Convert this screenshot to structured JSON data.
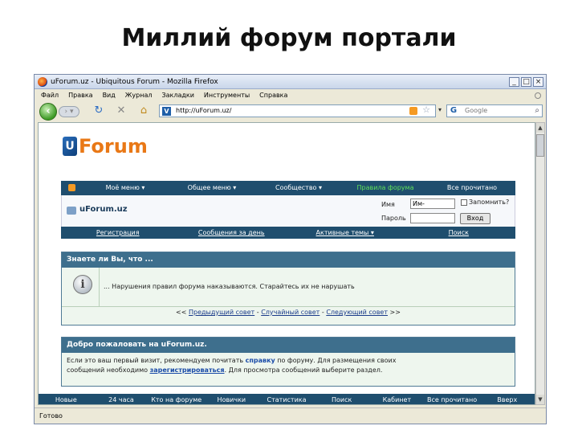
{
  "slide": {
    "title": "Миллий форум портали"
  },
  "browser": {
    "window_title": "uForum.uz - Ubiquitous Forum - Mozilla Firefox",
    "menu": [
      "Файл",
      "Правка",
      "Вид",
      "Журнал",
      "Закладки",
      "Инструменты",
      "Справка"
    ],
    "url": "http://uForum.uz/",
    "search_placeholder": "Google",
    "status": "Готово"
  },
  "forum": {
    "logo": {
      "mark": "U",
      "word": "Forum"
    },
    "top_nav": [
      "Моё меню ▾",
      "Общее меню ▾",
      "Сообщество ▾",
      "Правила форума",
      "Все прочитано"
    ],
    "site_name": "uForum.uz",
    "login": {
      "name_label": "Имя",
      "name_value": "Им-",
      "password_label": "Пароль",
      "remember_label": "Запомнить?",
      "button": "Вход"
    },
    "sub_nav": [
      "Регистрация",
      "Сообщения за день",
      "Активные темы ▾",
      "Поиск"
    ],
    "tip": {
      "header": "Знаете ли Вы, что ...",
      "text": "... Нарушения правил форума наказываются. Старайтесь их не нарушать",
      "prev_arrows": "<<",
      "prev": "Предыдущий совет",
      "sep1": "-",
      "random": "Случайный совет",
      "sep2": "-",
      "next": "Следующий совет",
      "next_arrows": ">>"
    },
    "welcome": {
      "header": "Добро пожаловать на uForum.uz.",
      "line1_a": "Если это ваш первый визит, рекомендуем почитать ",
      "line1_link": "справку",
      "line1_b": " по форуму. Для размещения своих",
      "line2_a": "сообщений необходимо ",
      "line2_link": "зарегистрироваться",
      "line2_b": ". Для просмотра сообщений выберите раздел."
    },
    "bottom_nav": [
      "Новые",
      "24 часа",
      "Кто на форуме",
      "Новички",
      "Статистика",
      "Поиск",
      "Кабинет",
      "Все прочитано",
      "Вверх"
    ]
  }
}
